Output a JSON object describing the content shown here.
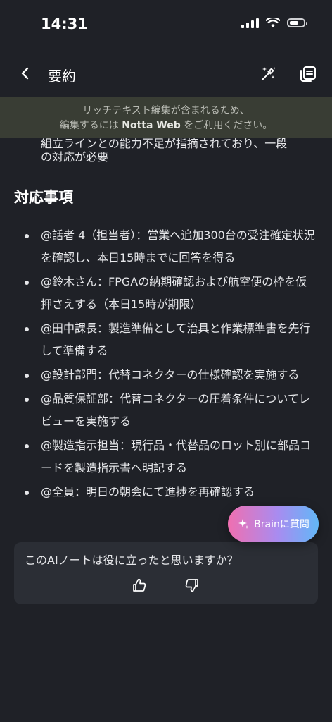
{
  "status": {
    "time": "14:31"
  },
  "nav": {
    "title": "要約"
  },
  "banner": {
    "line1": "リッチテキスト編集が含まれるため、",
    "line2_pre": "編集するには ",
    "line2_bold": "Notta Web",
    "line2_post": " をご利用ください。"
  },
  "cut_text": {
    "line1": "組立ラインとの能力不足が指摘されており、一段",
    "line2": "の対応が必要"
  },
  "section": {
    "title": "対応事項"
  },
  "action_items": [
    {
      "text": "@話者 4（担当者）：営業へ追加300台の受注確定状況を確認し、本日15時までに回答を得る"
    },
    {
      "text": "@鈴木さん：FPGAの納期確認および航空便の枠を仮押さえする（本日15時が期限）"
    },
    {
      "text": "@田中課長：製造準備として治具と作業標準書を先行して準備する"
    },
    {
      "text": "@設計部門：代替コネクターの仕様確認を実施する"
    },
    {
      "text": "@品質保証部：代替コネクターの圧着条件についてレビューを実施する"
    },
    {
      "text": "@製造指示担当：現行品・代替品のロット別に部品コードを製造指示書へ明記する"
    },
    {
      "text": "@全員：明日の朝会にて進捗を再確認する"
    }
  ],
  "feedback": {
    "question": "このAIノートは役に立ったと思いますか？"
  },
  "brain_button": {
    "label": "Brainに質問"
  },
  "colors": {
    "background": "#1f2127",
    "banner": "#393d34",
    "card": "#2b2e35",
    "accent_start": "#f06fb0",
    "accent_end": "#62b7f7"
  }
}
